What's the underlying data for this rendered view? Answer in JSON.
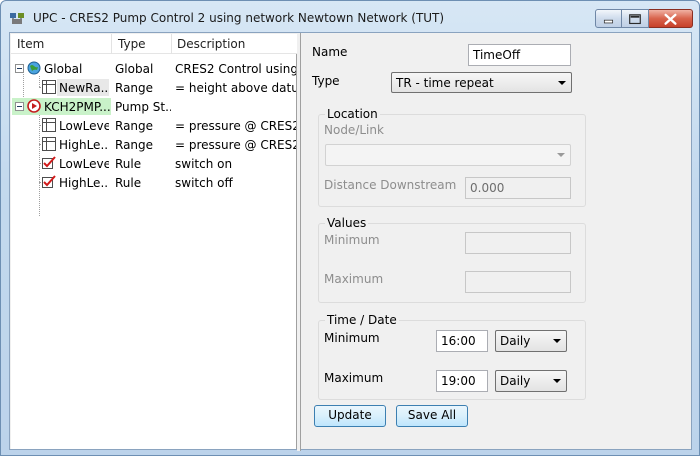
{
  "window": {
    "title": "UPC - CRES2 Pump Control 2  using network Newtown Network (TUT)",
    "accent": "#bcd3eb"
  },
  "tree": {
    "headers": [
      "Item",
      "Type",
      "Description"
    ],
    "rows": [
      {
        "item": "Global",
        "type": "Global",
        "description": "CRES2 Control using...",
        "icon": "globe-icon",
        "level": 0
      },
      {
        "item": "NewRa...",
        "type": "Range",
        "description": "= height above datu...",
        "icon": "range-grid-icon",
        "level": 1
      },
      {
        "item": "KCH2PMP...",
        "type": "Pump St...",
        "description": "",
        "icon": "play-circle-icon",
        "level": 0
      },
      {
        "item": "LowLevel",
        "type": "Range",
        "description": "= pressure @ CRES2 ...",
        "icon": "range-grid-icon",
        "level": 1
      },
      {
        "item": "HighLe...",
        "type": "Range",
        "description": "= pressure @ CRES2 ...",
        "icon": "range-grid-icon",
        "level": 1
      },
      {
        "item": "LowLevel",
        "type": "Rule",
        "description": "switch on",
        "icon": "rule-check-icon",
        "level": 1
      },
      {
        "item": "HighLe...",
        "type": "Rule",
        "description": "switch off",
        "icon": "rule-check-icon",
        "level": 1
      }
    ]
  },
  "form": {
    "name_label": "Name",
    "name_value": "TimeOff",
    "type_label": "Type",
    "type_value": "TR - time repeat",
    "location": {
      "title": "Location",
      "node_link_label": "Node/Link",
      "node_link_value": "",
      "distance_label": "Distance Downstream",
      "distance_value": "0.000"
    },
    "values": {
      "title": "Values",
      "minimum_label": "Minimum",
      "minimum_value": "",
      "maximum_label": "Maximum",
      "maximum_value": ""
    },
    "time_date": {
      "title": "Time / Date",
      "minimum_label": "Minimum",
      "minimum_time": "16:00",
      "minimum_period": "Daily",
      "maximum_label": "Maximum",
      "maximum_time": "19:00",
      "maximum_period": "Daily"
    },
    "update_label": "Update",
    "save_all_label": "Save All"
  }
}
